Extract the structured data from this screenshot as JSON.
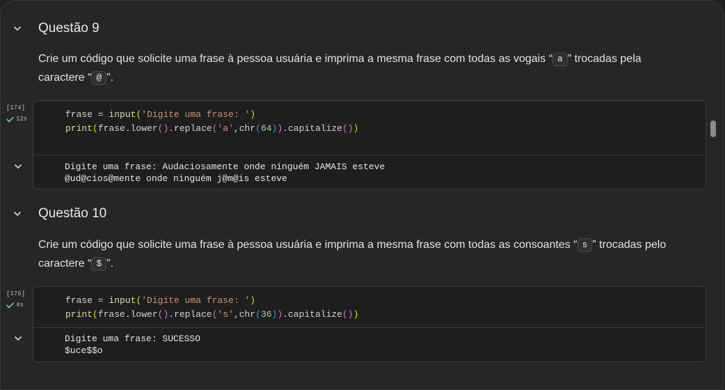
{
  "sections": [
    {
      "title": "Questão 9",
      "desc_before": "Crie um código que solicite uma frase à pessoa usuária e imprima a mesma frase com todas as vogais “",
      "chip1": "a",
      "desc_middle": "” trocadas pela caractere “",
      "chip2": "@",
      "desc_after": "”.",
      "exec_count": "[174]",
      "exec_time": "12s",
      "code": {
        "l1_a": "frase = ",
        "l1_fn": "input",
        "l1_open": "(",
        "l1_str": "'Digite uma frase: '",
        "l1_close": ")",
        "l2_fn": "print",
        "l2_open": "(",
        "l2_mid1": "frase.lower",
        "l2_paren1": "()",
        "l2_mid2": ".replace",
        "l2_open2": "(",
        "l2_str": "'a'",
        "l2_comma": ",chr",
        "l2_open3": "(",
        "l2_num": "64",
        "l2_close3": ")",
        "l2_close2": ")",
        "l2_mid3": ".capitalize",
        "l2_paren2": "()",
        "l2_close": ")"
      },
      "output_lines": [
        "Digite uma frase: Audaciosamente onde ninguém JAMAIS esteve",
        "@ud@cios@mente onde ninguém j@m@is esteve"
      ]
    },
    {
      "title": "Questão 10",
      "desc_before": "Crie um código que solicite uma frase à pessoa usuária e imprima a mesma frase com todas as consoantes “",
      "chip1": "s",
      "desc_middle": "” trocadas pelo caractere “",
      "chip2": "$",
      "desc_after": "”.",
      "exec_count": "[176]",
      "exec_time": "4s",
      "code": {
        "l1_a": "frase = ",
        "l1_fn": "input",
        "l1_open": "(",
        "l1_str": "'Digite uma frase: '",
        "l1_close": ")",
        "l2_fn": "print",
        "l2_open": "(",
        "l2_mid1": "frase.lower",
        "l2_paren1": "()",
        "l2_mid2": ".replace",
        "l2_open2": "(",
        "l2_str": "'s'",
        "l2_comma": ",chr",
        "l2_open3": "(",
        "l2_num": "36",
        "l2_close3": ")",
        "l2_close2": ")",
        "l2_mid3": ".capitalize",
        "l2_paren2": "()",
        "l2_close": ")"
      },
      "output_lines": [
        "Digite uma frase: SUCESSO",
        "$uce$$o"
      ]
    }
  ],
  "icons": {
    "collapse": "chevron-down-icon",
    "success": "check-icon"
  },
  "colors": {
    "background": "#262626",
    "success": "#6ccf7f"
  }
}
